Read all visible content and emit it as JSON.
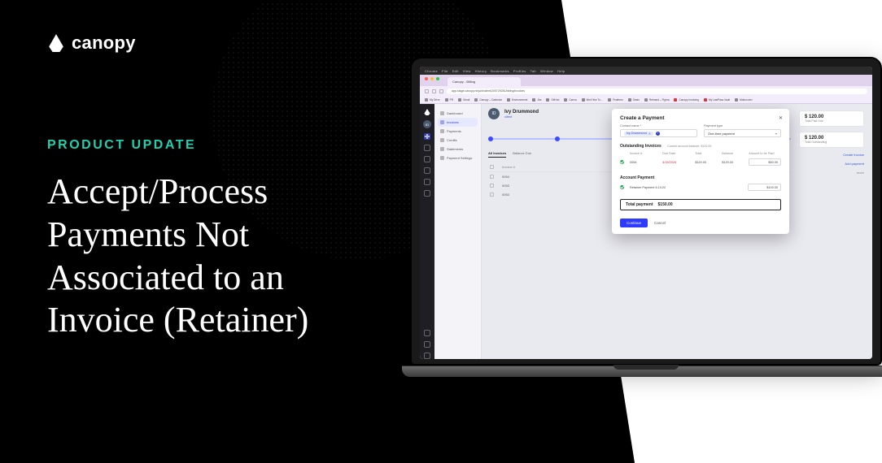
{
  "marketing": {
    "logo_text": "canopy",
    "kicker": "PRODUCT UPDATE",
    "headline": "Accept/Process Payments Not Associated to an Invoice (Retainer)"
  },
  "mac_menu": [
    "Chrome",
    "File",
    "Edit",
    "View",
    "History",
    "Bookmarks",
    "Profiles",
    "Tab",
    "Window",
    "Help"
  ],
  "chrome": {
    "tab_title": "Canopy - Billing",
    "url": "app-stage.canopy.ninja/#/client/200729281/billing/invoices",
    "bookmarks": [
      "My Drive",
      "PR",
      "Gmail",
      "Canopy – Calendar",
      "Environments",
      "Jira",
      "GitHub",
      "Canva",
      "Mini Hive To…",
      "Feathers",
      "Oasis",
      "Rebrand – Figma",
      "Canopy Invoicing",
      "My LastPass Vault",
      "Motion.dev"
    ]
  },
  "app": {
    "client_name": "Ivy Drummond",
    "client_avatar": "ID",
    "client_sub": "client",
    "subnav": [
      "Dashboard",
      "Invoices",
      "Payments",
      "Credits",
      "Statements",
      "Payment Settings"
    ],
    "subnav_active_index": 1,
    "summary": [
      {
        "amount": "$ 120.00",
        "label": "Total Paid Due"
      },
      {
        "amount": "$ 120.00",
        "label": "Total Outstanding"
      }
    ],
    "create_invoice": "Create Invoice",
    "add_payment": "Add payment",
    "more": "more",
    "tabs": [
      "All Invoices",
      "Balance Due"
    ],
    "tabs_active_index": 0,
    "table": {
      "columns": [
        "Invoice #"
      ],
      "rows": [
        "0054",
        "0053",
        "0053"
      ]
    }
  },
  "modal": {
    "title": "Create a Payment",
    "contact_label": "Contact name *",
    "contact_value": "Ivy Drummond",
    "type_label": "Payment type",
    "type_value": "One-time payment",
    "outstanding_title": "Outstanding Invoices",
    "balance_note": "Current account balance: $120.00",
    "inv_columns": [
      "Invoice #",
      "Due Date",
      "Total",
      "Balance",
      "Amount to be Paid"
    ],
    "inv_row": {
      "num": "0054",
      "due": "4/19/2024",
      "total": "$120.00",
      "balance": "$120.00",
      "amount": "$50.00"
    },
    "acct_title": "Account Payment",
    "acct_label": "Retainer Payment 6.14.22",
    "acct_amount": "$100.00",
    "total_label": "Total payment",
    "total_value": "$150.00",
    "continue": "Continue",
    "cancel": "Cancel"
  }
}
